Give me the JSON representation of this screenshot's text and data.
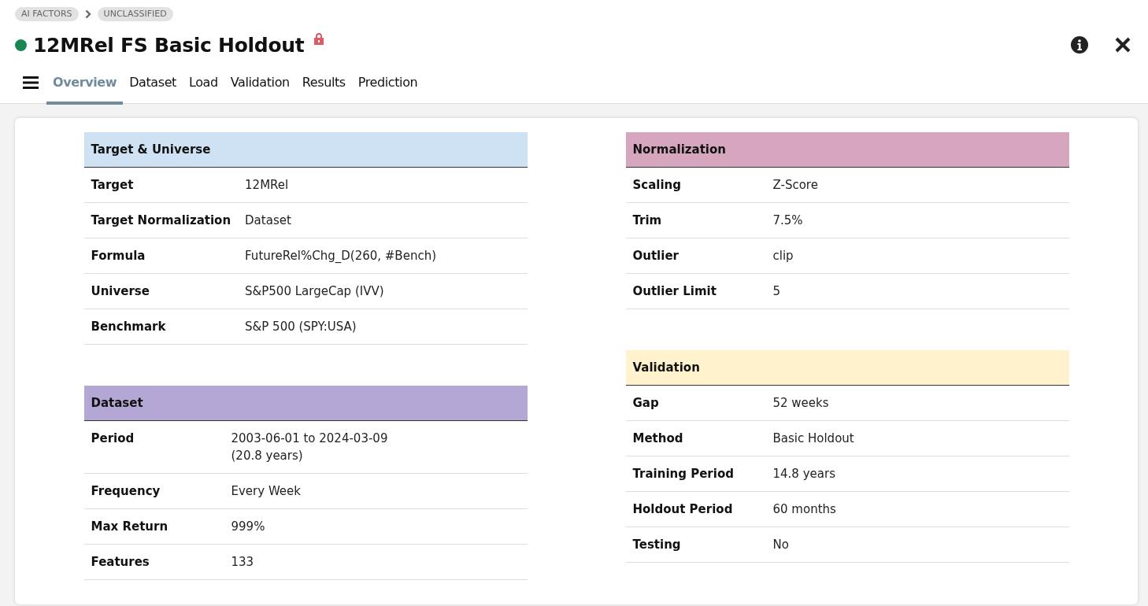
{
  "breadcrumb": [
    "AI FACTORS",
    "UNCLASSIFIED"
  ],
  "title": "12MRel FS Basic Holdout",
  "tabs": [
    {
      "label": "Overview",
      "selected": true
    },
    {
      "label": "Dataset",
      "selected": false
    },
    {
      "label": "Load",
      "selected": false
    },
    {
      "label": "Validation",
      "selected": false
    },
    {
      "label": "Results",
      "selected": false
    },
    {
      "label": "Prediction",
      "selected": false
    }
  ],
  "columns": [
    [
      {
        "title": "Target & Universe",
        "color": "#cfe2f3",
        "rows": [
          {
            "label": "Target",
            "value": "12MRel"
          },
          {
            "label": "Target Normalization",
            "value": "Dataset"
          },
          {
            "label": "Formula",
            "value": "FutureRel%Chg_D(260, #Bench)"
          },
          {
            "label": "Universe",
            "value": "S&P500 LargeCap (IVV)"
          },
          {
            "label": "Benchmark",
            "value": "S&P 500 (SPY:USA)"
          }
        ]
      },
      {
        "title": "Dataset",
        "color": "#b4a7d6",
        "rows": [
          {
            "label": "Period",
            "value": "2003-06-01 to 2024-03-09",
            "note": "(20.8 years)"
          },
          {
            "label": "Frequency",
            "value": "Every Week"
          },
          {
            "label": "Max Return",
            "value": "999%"
          },
          {
            "label": "Features",
            "value": "133"
          }
        ]
      }
    ],
    [
      {
        "title": "Normalization",
        "color": "#d5a6bd",
        "rows": [
          {
            "label": "Scaling",
            "value": "Z-Score"
          },
          {
            "label": "Trim",
            "value": "7.5%"
          },
          {
            "label": "Outlier",
            "value": "clip"
          },
          {
            "label": "Outlier Limit",
            "value": "5"
          }
        ]
      },
      {
        "title": "Validation",
        "color": "#fff2cc",
        "rows": [
          {
            "label": "Gap",
            "value": "52 weeks"
          },
          {
            "label": "Method",
            "value": "Basic Holdout"
          },
          {
            "label": "Training Period",
            "value": "14.8 years"
          },
          {
            "label": "Holdout Period",
            "value": "60 months"
          },
          {
            "label": "Testing",
            "value": "No"
          }
        ]
      }
    ]
  ]
}
